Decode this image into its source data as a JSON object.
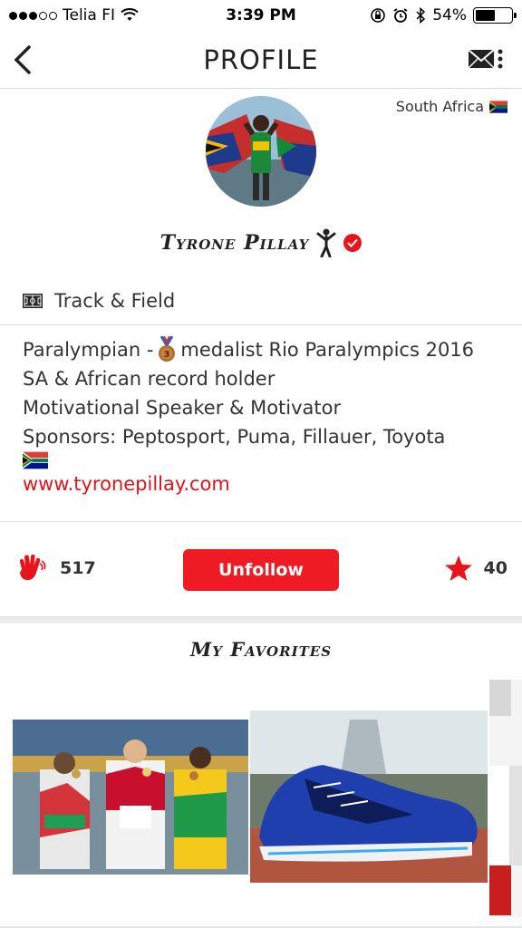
{
  "status_bar": {
    "carrier": "Telia FI",
    "time": "3:39 PM",
    "battery": "54%",
    "battery_level": 0.54
  },
  "header": {
    "title": "PROFILE",
    "back_icon": "chevron-left-icon",
    "mail_icon": "envelope-menu-icon"
  },
  "profile": {
    "country": "South Africa",
    "name": "Tyrone Pillay",
    "sport": "Track & Field",
    "bio": {
      "line1_prefix": "Paralympian -",
      "line1_suffix": "medalist Rio Paralympics 2016",
      "line2": "SA & African record holder",
      "line3": "Motivational Speaker & Motivator",
      "line4": "Sponsors: Peptosport, Puma, Fillauer, Toyota"
    },
    "website": "www.tyronepillay.com"
  },
  "stats": {
    "claps": "517",
    "unfollow_label": "Unfollow",
    "stars": "40"
  },
  "favorites": {
    "title": "My Favorites"
  },
  "colors": {
    "accent": "#ee1b24",
    "link": "#e0141c"
  }
}
